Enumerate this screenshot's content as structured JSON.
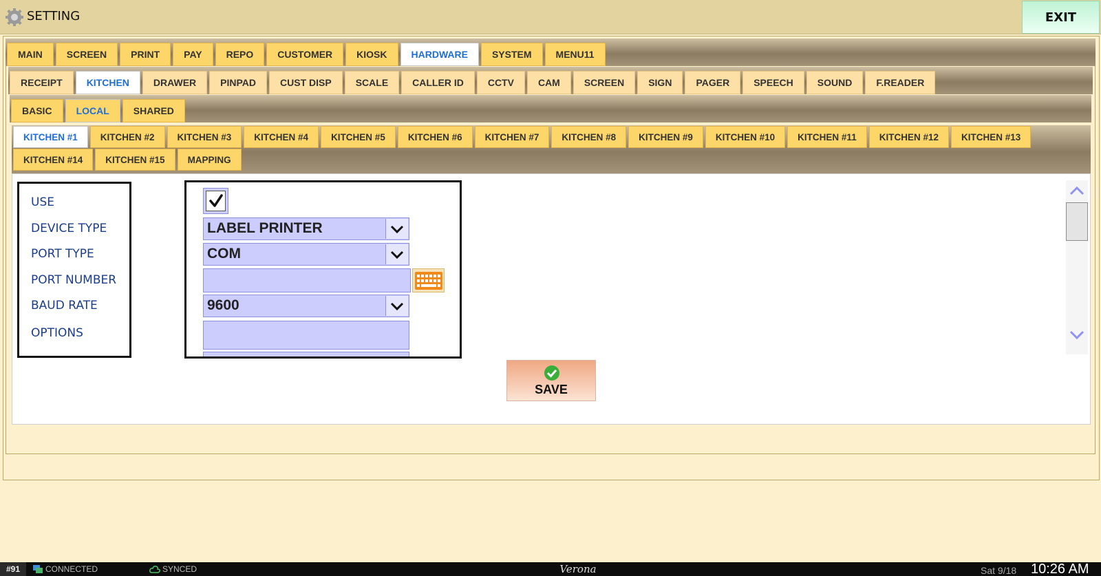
{
  "window": {
    "title": "SETTING",
    "exit_label": "EXIT"
  },
  "main_tabs": [
    "MAIN",
    "SCREEN",
    "PRINT",
    "PAY",
    "REPO",
    "CUSTOMER",
    "KIOSK",
    "HARDWARE",
    "SYSTEM",
    "MENU11"
  ],
  "main_active": "HARDWARE",
  "hardware_tabs": [
    "RECEIPT",
    "KITCHEN",
    "DRAWER",
    "PINPAD",
    "CUST DISP",
    "SCALE",
    "CALLER ID",
    "CCTV",
    "CAM",
    "SCREEN",
    "SIGN",
    "PAGER",
    "SPEECH",
    "SOUND",
    "F.READER"
  ],
  "hardware_active": "KITCHEN",
  "kitchen_mode_tabs": [
    "BASIC",
    "LOCAL",
    "SHARED"
  ],
  "kitchen_mode_active": "LOCAL",
  "kitchen_tabs_row1": [
    "KITCHEN #1",
    "KITCHEN #2",
    "KITCHEN #3",
    "KITCHEN #4",
    "KITCHEN #5",
    "KITCHEN #6",
    "KITCHEN #7",
    "KITCHEN #8",
    "KITCHEN #9",
    "KITCHEN #10",
    "KITCHEN #11",
    "KITCHEN #12",
    "KITCHEN #13"
  ],
  "kitchen_tabs_row2": [
    "KITCHEN #14",
    "KITCHEN #15",
    "MAPPING"
  ],
  "kitchen_active": "KITCHEN #1",
  "form": {
    "labels": {
      "use": "USE",
      "device_type": "DEVICE TYPE",
      "port_type": "PORT TYPE",
      "port_number": "PORT NUMBER",
      "baud_rate": "BAUD RATE",
      "options": "OPTIONS"
    },
    "use_checked": true,
    "device_type": "LABEL PRINTER",
    "port_type": "COM",
    "port_number": "",
    "baud_rate": "9600",
    "options": ""
  },
  "save_label": "SAVE",
  "status": {
    "terminal": "#91",
    "connection": "CONNECTED",
    "sync": "SYNCED",
    "brand": "Verona",
    "date": "Sat 9/18",
    "time": "10:26 AM"
  },
  "icons": {
    "title": "gear-icon",
    "keyboard": "keyboard-icon",
    "save": "check-circle-icon",
    "scroll_up": "chevron-up-icon",
    "scroll_down": "chevron-down-icon"
  },
  "colors": {
    "tab": "#fdd66a",
    "tab_active_text": "#1d6fd6",
    "field": "#cccdfd",
    "label_text": "#1a3e8c"
  }
}
